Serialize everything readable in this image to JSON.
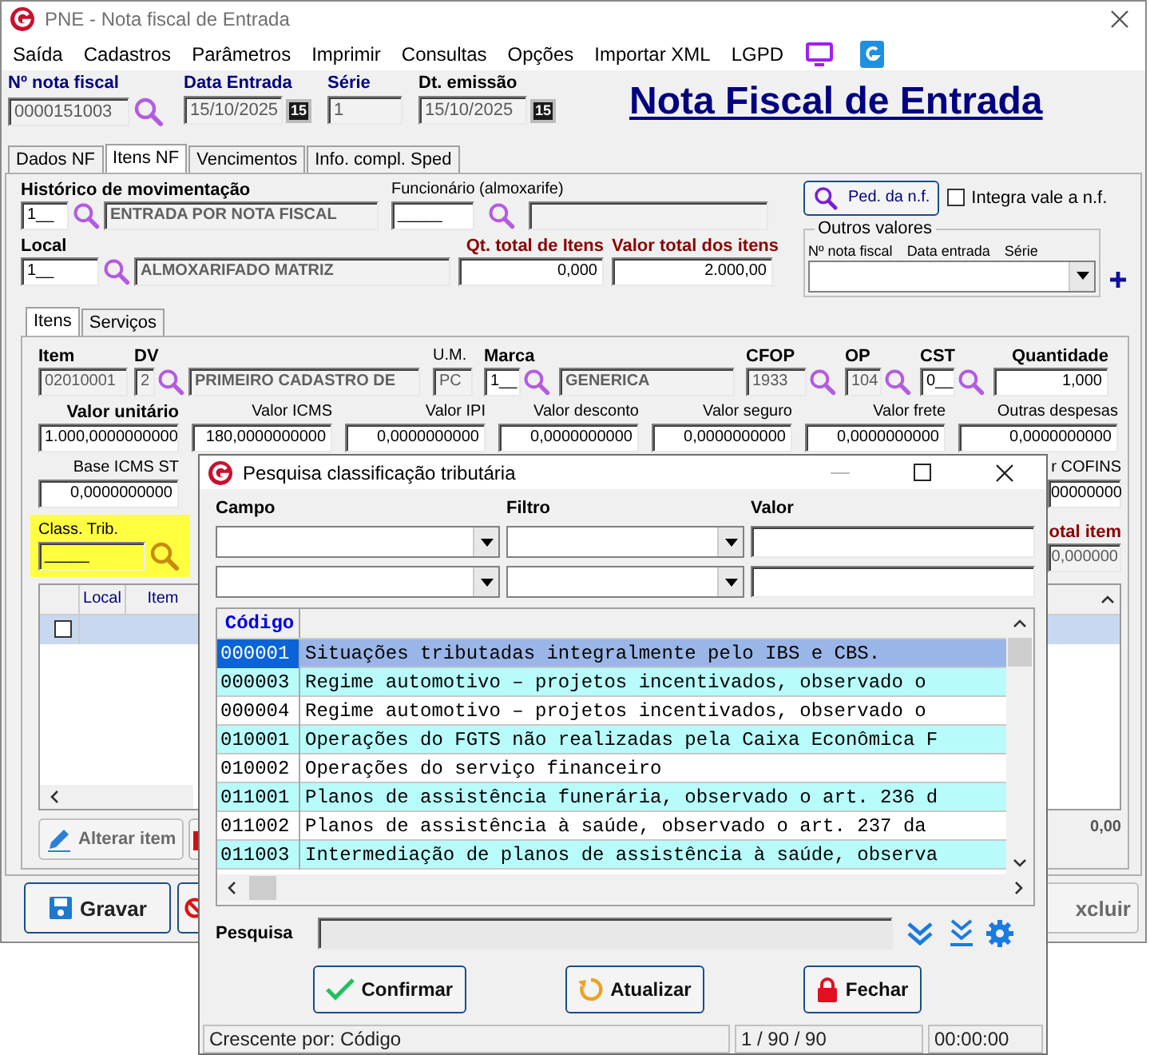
{
  "window": {
    "title": "PNE - Nota fiscal de Entrada"
  },
  "menu": [
    "Saída",
    "Cadastros",
    "Parâmetros",
    "Imprimir",
    "Consultas",
    "Opções",
    "Importar XML",
    "LGPD"
  ],
  "header": {
    "fields": [
      {
        "label": "Nº nota fiscal",
        "value": "0000151003",
        "disabled": true,
        "lookup": true
      },
      {
        "label": "Data Entrada",
        "value": "15/10/2025",
        "disabled": true,
        "calendar": "15"
      },
      {
        "label": "Série",
        "value": "1",
        "disabled": true
      },
      {
        "label": "Dt. emissão",
        "value": "15/10/2025",
        "disabled": true,
        "calendar": "15"
      }
    ],
    "heading": "Nota Fiscal de Entrada"
  },
  "tabs": [
    {
      "label": "Dados NF",
      "selected": false
    },
    {
      "label": "Itens NF",
      "selected": true
    },
    {
      "label": "Vencimentos",
      "selected": false
    },
    {
      "label": "Info. compl. Sped",
      "selected": false
    }
  ],
  "movement": {
    "label": "Histórico de movimentação",
    "code": "1__",
    "description": "ENTRADA POR NOTA FISCAL"
  },
  "employee": {
    "label": "Funcionário (almoxarife)",
    "code": "_____"
  },
  "order_button": "Ped. da n.f.",
  "integrate": {
    "label": "Integra vale a n.f.",
    "checked": false
  },
  "location": {
    "label": "Local",
    "code": "1__",
    "description": "ALMOXARIFADO MATRIZ"
  },
  "totals": [
    {
      "label": "Qt. total de Itens",
      "value": "0,000"
    },
    {
      "label": "Valor total dos itens",
      "value": "2.000,00"
    }
  ],
  "other_values": {
    "title": "Outros valores",
    "columns": [
      "Nº nota fiscal",
      "Data entrada",
      "Série"
    ]
  },
  "inner_tabs": [
    {
      "label": "Itens",
      "selected": true
    },
    {
      "label": "Serviços",
      "selected": false
    }
  ],
  "item_fields": [
    {
      "label": "Item",
      "value": "02010001",
      "kind": "text",
      "disabled": true
    },
    {
      "label": "DV",
      "value": "2",
      "kind": "text",
      "disabled": true,
      "lookup": true
    },
    {
      "value": "PRIMEIRO CADASTRO DE",
      "kind": "desc",
      "disabled": true
    },
    {
      "label": "U.M.",
      "value": "PC",
      "kind": "text",
      "disabled": true
    },
    {
      "label": "Marca",
      "value": "1__",
      "kind": "text",
      "disabled": false,
      "lookup": true
    },
    {
      "value": "GENERICA",
      "kind": "desc",
      "disabled": true
    },
    {
      "label": "CFOP",
      "value": "1933",
      "kind": "text",
      "disabled": true,
      "lookup": true
    },
    {
      "label": "OP",
      "value": "104",
      "kind": "text",
      "disabled": true,
      "lookup": true
    },
    {
      "label": "CST",
      "value": "0__",
      "kind": "text",
      "disabled": false,
      "lookup": true
    },
    {
      "label": "Quantidade",
      "value": "1,000",
      "kind": "number",
      "disabled": false
    }
  ],
  "value_fields": [
    {
      "label": "Valor unitário",
      "value": "1.000,0000000000"
    },
    {
      "label": "Valor ICMS",
      "value": "180,0000000000"
    },
    {
      "label": "Valor IPI",
      "value": "0,0000000000"
    },
    {
      "label": "Valor desconto",
      "value": "0,0000000000"
    },
    {
      "label": "Valor seguro",
      "value": "0,0000000000"
    },
    {
      "label": "Valor frete",
      "value": "0,0000000000"
    },
    {
      "label": "Outras despesas",
      "value": "0,0000000000"
    }
  ],
  "base_icms_st": {
    "label": "Base ICMS ST",
    "value": "0,0000000000"
  },
  "cofins": {
    "label": "r COFINS",
    "value": "00000000"
  },
  "class_trib": {
    "label": "Class. Trib.",
    "value": "_____"
  },
  "total_item": {
    "label": "otal item",
    "value": "0,000000"
  },
  "items_grid": {
    "columns": [
      "Local",
      "Item"
    ],
    "rows": [
      {
        "checked": false,
        "selected": true
      }
    ]
  },
  "item_buttons": [
    {
      "label": "Alterar item",
      "kind": "edit",
      "disabled": true
    },
    {
      "kind": "delete"
    }
  ],
  "items_total": "0,00",
  "bottom_buttons": [
    {
      "label": "Gravar",
      "kind": "save",
      "disabled": false
    },
    {
      "kind": "cancel"
    },
    {
      "label": "xcluir",
      "kind": "delete",
      "disabled": true
    }
  ],
  "dialog": {
    "title": "Pesquisa classificação tributária",
    "filter_labels": [
      "Campo",
      "Filtro",
      "Valor"
    ],
    "grid": {
      "columns": [
        "Código"
      ],
      "rows": [
        {
          "code": "000001",
          "description": "Situações tributadas integralmente pelo IBS e CBS.",
          "selected": true
        },
        {
          "code": "000003",
          "description": "Regime automotivo – projetos incentivados, observado o",
          "selected": false
        },
        {
          "code": "000004",
          "description": "Regime automotivo – projetos incentivados, observado o",
          "selected": false
        },
        {
          "code": "010001",
          "description": "Operações do FGTS não realizadas pela Caixa Econômica F",
          "selected": false
        },
        {
          "code": "010002",
          "description": "Operações do serviço financeiro",
          "selected": false
        },
        {
          "code": "011001",
          "description": "Planos de assistência funerária, observado o art. 236 d",
          "selected": false
        },
        {
          "code": "011002",
          "description": "Planos de assistência à saúde, observado o art. 237 da",
          "selected": false
        },
        {
          "code": "011003",
          "description": "Intermediação de planos de assistência à saúde, observa",
          "selected": false
        }
      ]
    },
    "search_label": "Pesquisa",
    "buttons": [
      {
        "label": "Confirmar",
        "kind": "confirm"
      },
      {
        "label": "Atualizar",
        "kind": "refresh"
      },
      {
        "label": "Fechar",
        "kind": "close"
      }
    ],
    "status_bar": [
      "Crescente por: Código",
      "1 / 90 / 90",
      "00:00:00"
    ]
  }
}
